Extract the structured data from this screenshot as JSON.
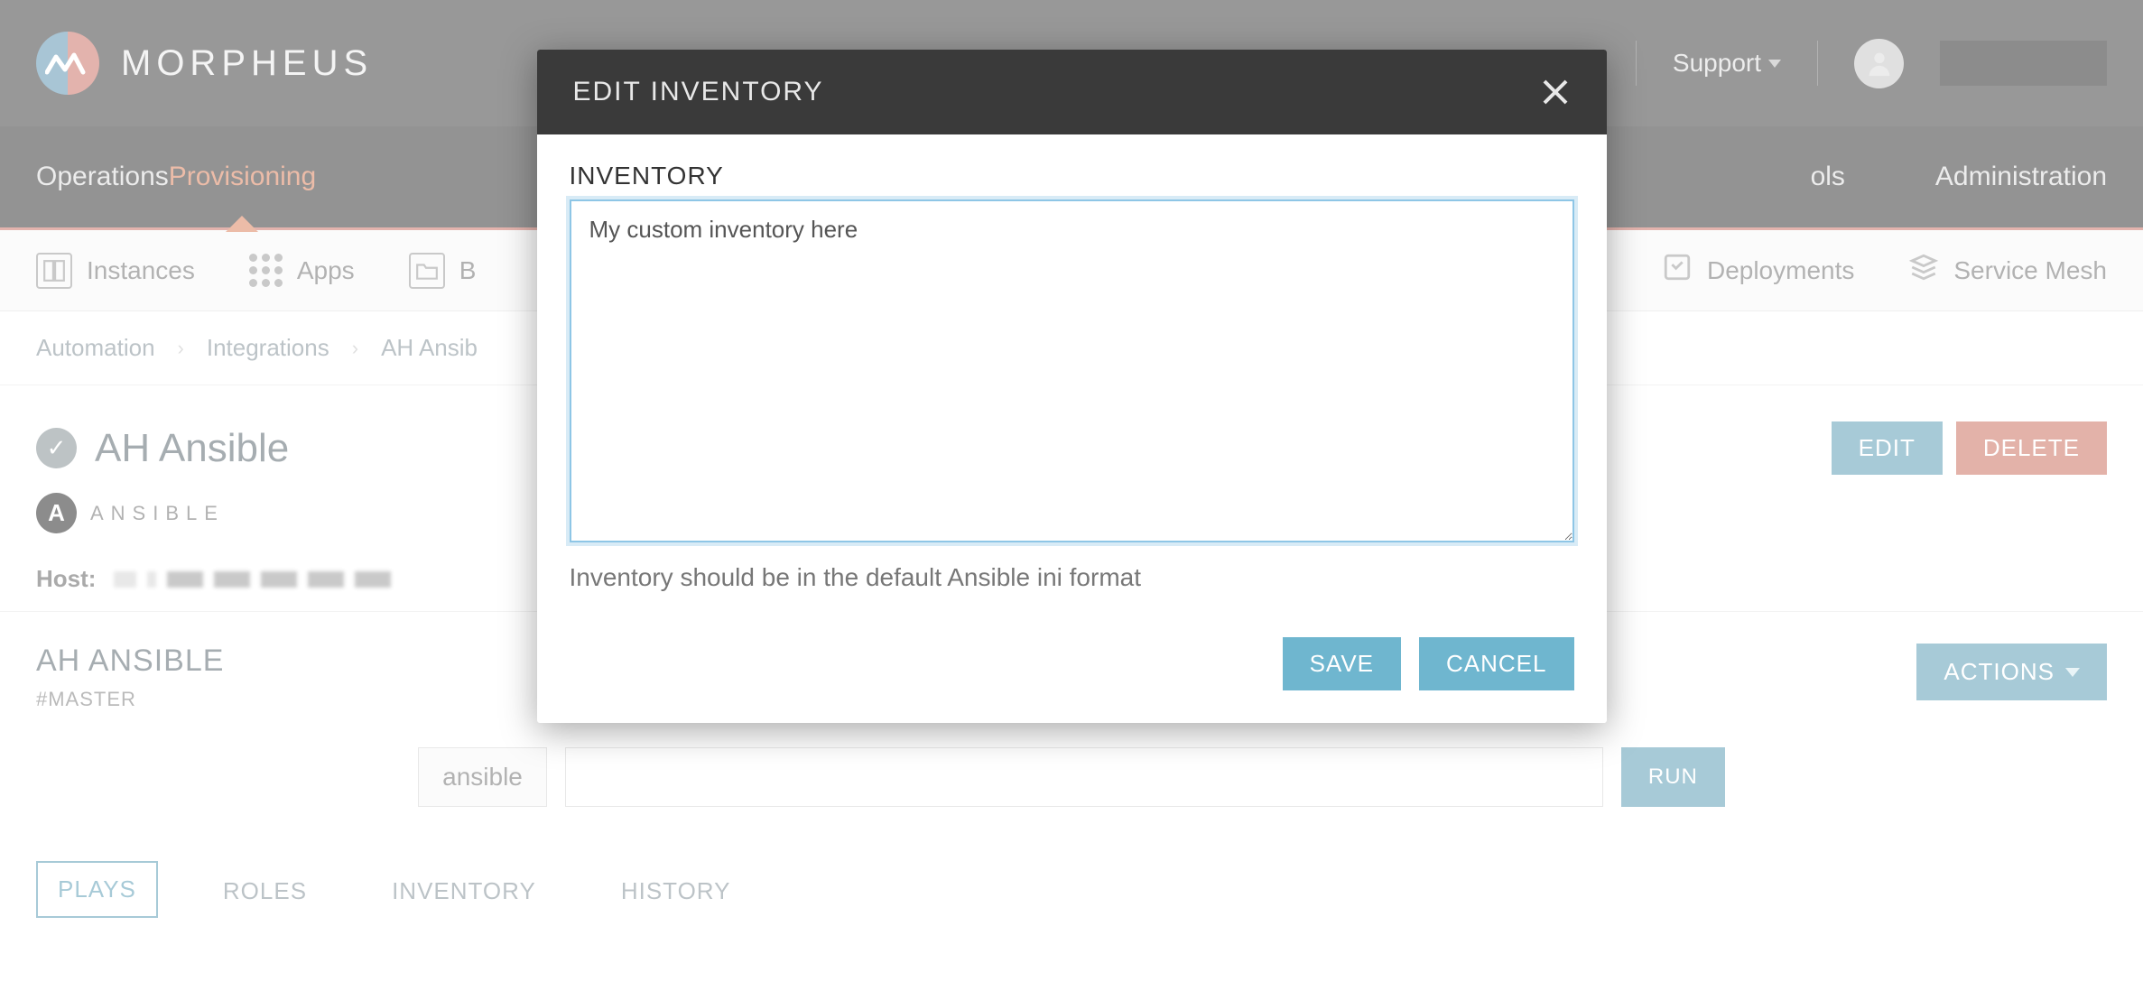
{
  "brand": {
    "name": "MORPHEUS"
  },
  "header": {
    "support_label": "Support"
  },
  "primary_nav": {
    "items": [
      {
        "label": "Operations"
      },
      {
        "label": "Provisioning",
        "active": true
      },
      {
        "label": "Tools"
      },
      {
        "label": "Administration"
      }
    ],
    "hidden_partial": "ols"
  },
  "sub_nav": {
    "items": [
      {
        "label": "Instances"
      },
      {
        "label": "Apps"
      },
      {
        "label": "B",
        "truncated": true
      },
      {
        "label": "Deployments"
      },
      {
        "label": "Service Mesh"
      }
    ]
  },
  "breadcrumb": {
    "items": [
      "Automation",
      "Integrations",
      "AH Ansib"
    ]
  },
  "page": {
    "title": "AH Ansible",
    "edit_label": "EDIT",
    "delete_label": "DELETE",
    "integration_name": "ANSIBLE",
    "host_label": "Host:"
  },
  "section": {
    "title": "AH ANSIBLE",
    "subtitle": "#MASTER",
    "actions_label": "ACTIONS",
    "run_label": "ansible",
    "run_button": "RUN"
  },
  "tabs": {
    "items": [
      {
        "label": "PLAYS",
        "active": true
      },
      {
        "label": "ROLES"
      },
      {
        "label": "INVENTORY"
      },
      {
        "label": "HISTORY"
      }
    ]
  },
  "modal": {
    "title": "EDIT INVENTORY",
    "field_label": "INVENTORY",
    "textarea_value": "My custom inventory here",
    "help_text": "Inventory should be in the default Ansible ini format",
    "save_label": "SAVE",
    "cancel_label": "CANCEL"
  }
}
